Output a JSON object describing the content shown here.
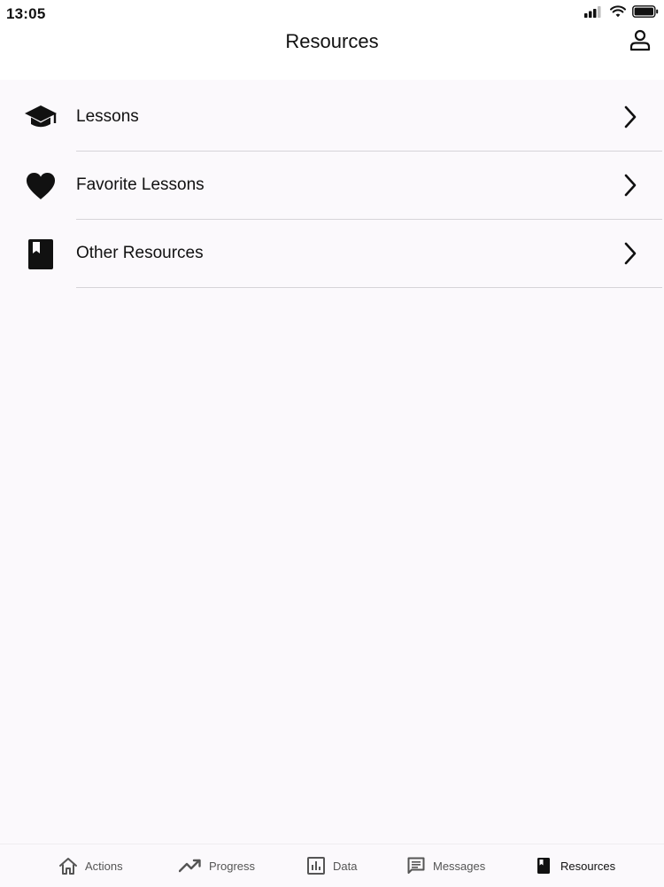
{
  "status_bar": {
    "time": "13:05"
  },
  "header": {
    "title": "Resources"
  },
  "list": {
    "items": [
      {
        "label": "Lessons",
        "icon": "graduation-cap-icon"
      },
      {
        "label": "Favorite Lessons",
        "icon": "heart-icon"
      },
      {
        "label": "Other Resources",
        "icon": "book-icon"
      }
    ]
  },
  "tab_bar": {
    "tabs": [
      {
        "label": "Actions",
        "icon": "home-icon",
        "active": false
      },
      {
        "label": "Progress",
        "icon": "trending-up-icon",
        "active": false
      },
      {
        "label": "Data",
        "icon": "bar-chart-icon",
        "active": false
      },
      {
        "label": "Messages",
        "icon": "message-icon",
        "active": false
      },
      {
        "label": "Resources",
        "icon": "book-icon",
        "active": true
      }
    ]
  },
  "colors": {
    "background": "#fbf9fc",
    "header_background": "#ffffff",
    "divider": "#d6d4d8",
    "text": "#111111",
    "inactive_tab": "#555555"
  }
}
